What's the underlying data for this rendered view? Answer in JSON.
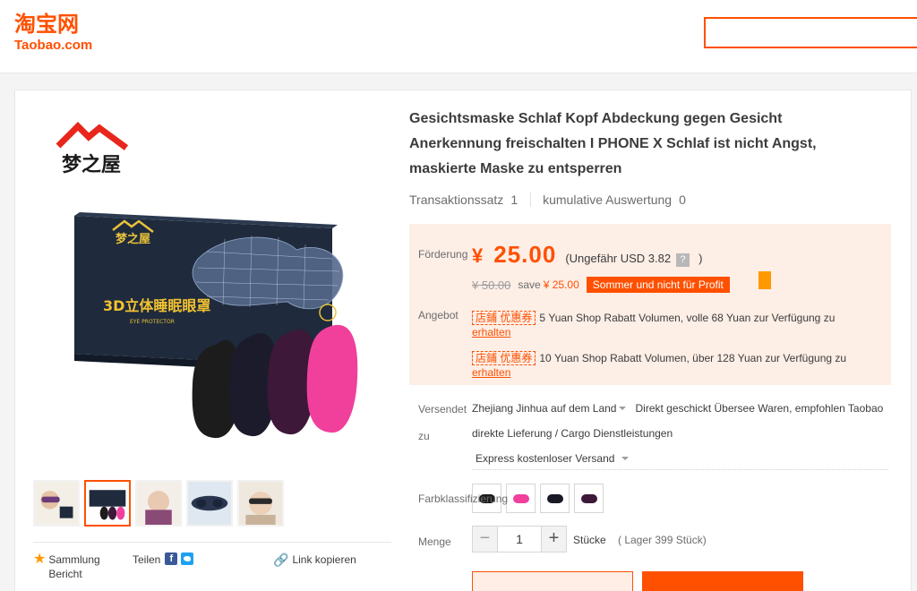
{
  "header": {
    "logo_cn": "淘宝网",
    "logo_en": "Taobao.com"
  },
  "search": {
    "placeholder": ""
  },
  "product": {
    "title": "Gesichtsmaske Schlaf Kopf Abdeckung gegen Gesicht Anerkennung freischalten I PHONE X Schlaf ist nicht Angst, maskierte Maske zu entsperren",
    "box_brand": "梦之屋",
    "box_text": "3D立体睡眠眼罩",
    "box_subtext": "EYE PROTECTOR",
    "stats": {
      "transactions_label": "Transaktionssatz",
      "transactions_value": "1",
      "reviews_label": "kumulative Auswertung",
      "reviews_value": "0"
    },
    "promo": {
      "price_label": "Förderung",
      "currency": "¥",
      "price": "25.00",
      "approx_open": "(Ungefähr USD 3.82",
      "approx_help": "?",
      "approx_close": ")",
      "old_price": "¥ 50.00",
      "save_label": "save",
      "save_value": "¥ 25.00",
      "promo_tag": "Sommer und nicht für Profit",
      "offer_label": "Angebot",
      "coupons": [
        {
          "tag": "店鋪 优惠券",
          "text": "5 Yuan Shop Rabatt Volumen, volle 68 Yuan zur Verfügung zu",
          "link": "erhalten"
        },
        {
          "tag": "店鋪 优惠券",
          "text": "10 Yuan Shop Rabatt Volumen, über 128 Yuan zur Verfügung zu",
          "link": "erhalten"
        }
      ]
    },
    "shipping": {
      "label": "Versendet zu",
      "origin": "Zhejiang Jinhua auf",
      "destination": "dem Land",
      "note": "Direkt geschickt Übersee Waren, empfohlen Taobao direkte Lieferung / Cargo Dienstleistungen",
      "method": "Express kostenloser Versand"
    },
    "color_label": "Farbklassifizierung",
    "colors": [
      "#1c1c1c",
      "#f0409c",
      "#1a1a26",
      "#3d1838"
    ],
    "quantity": {
      "label": "Menge",
      "minus": "−",
      "value": "1",
      "plus": "+",
      "unit": "Stücke",
      "stock": "( Lager 399 Stück)"
    }
  },
  "social": {
    "favorite": "Sammlung",
    "report": "Bericht",
    "share": "Teilen",
    "copy_link": "Link kopieren"
  }
}
